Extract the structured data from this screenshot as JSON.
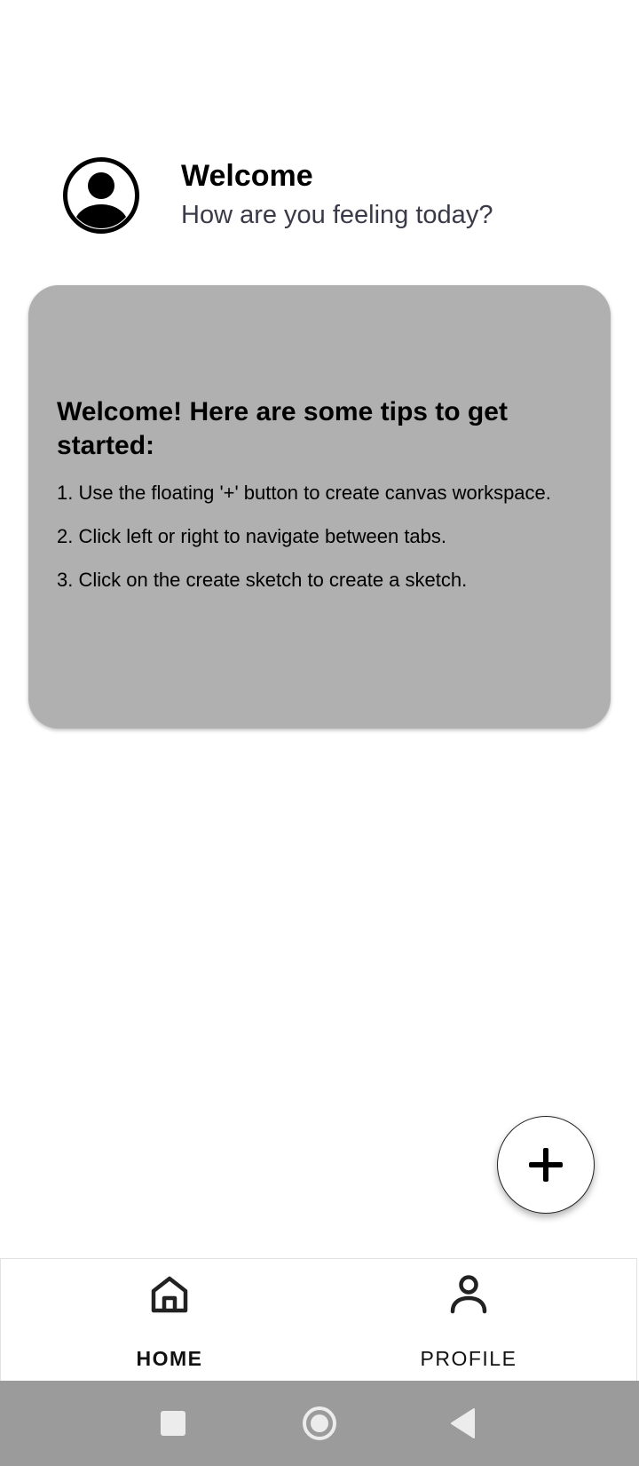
{
  "header": {
    "avatar_icon": "account-circle-icon",
    "title": "Welcome",
    "subtitle": "How are you feeling today?"
  },
  "tips_card": {
    "background_color": "#b1b0b1",
    "title": "Welcome! Here are some tips to get started:",
    "tips": [
      "1. Use the floating '+' button to create canvas workspace.",
      "2. Click left or right to navigate between tabs.",
      "3. Click on the create sketch to create a sketch."
    ]
  },
  "fab": {
    "icon": "plus-icon"
  },
  "bottom_nav": {
    "items": [
      {
        "label": "HOME",
        "icon": "home-icon",
        "active": true
      },
      {
        "label": "PROFILE",
        "icon": "person-icon",
        "active": false
      }
    ]
  },
  "system_nav": {
    "background_color": "#9b9b9b",
    "buttons": [
      "recents-square-icon",
      "home-circle-icon",
      "back-triangle-icon"
    ]
  }
}
